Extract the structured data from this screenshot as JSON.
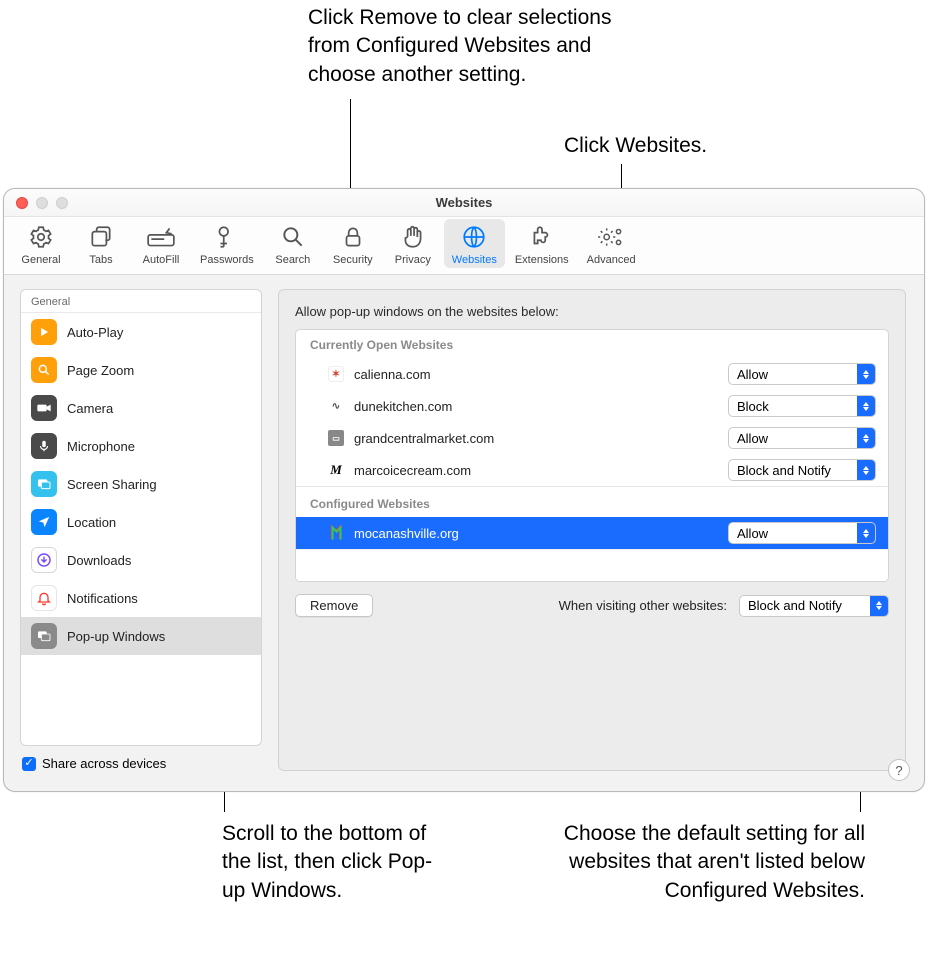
{
  "window_title": "Websites",
  "toolbar": [
    {
      "id": "general",
      "label": "General"
    },
    {
      "id": "tabs",
      "label": "Tabs"
    },
    {
      "id": "autofill",
      "label": "AutoFill"
    },
    {
      "id": "passwords",
      "label": "Passwords"
    },
    {
      "id": "search",
      "label": "Search"
    },
    {
      "id": "security",
      "label": "Security"
    },
    {
      "id": "privacy",
      "label": "Privacy"
    },
    {
      "id": "websites",
      "label": "Websites",
      "selected": true
    },
    {
      "id": "extensions",
      "label": "Extensions"
    },
    {
      "id": "advanced",
      "label": "Advanced"
    }
  ],
  "sidebar": {
    "header": "General",
    "items": [
      {
        "id": "autoplay",
        "label": "Auto-Play",
        "bg": "#ff9f0a"
      },
      {
        "id": "pagezoom",
        "label": "Page Zoom",
        "bg": "#ff9f0a"
      },
      {
        "id": "camera",
        "label": "Camera",
        "bg": "#4a4a4a"
      },
      {
        "id": "microphone",
        "label": "Microphone",
        "bg": "#4a4a4a"
      },
      {
        "id": "screenshare",
        "label": "Screen Sharing",
        "bg": "#0a84ff"
      },
      {
        "id": "location",
        "label": "Location",
        "bg": "#0a84ff"
      },
      {
        "id": "downloads",
        "label": "Downloads",
        "bg": "#7a4cff"
      },
      {
        "id": "notifications",
        "label": "Notifications",
        "bg": "#ffffff"
      },
      {
        "id": "popup",
        "label": "Pop-up Windows",
        "bg": "#8a8a8a",
        "selected": true
      }
    ],
    "share_label": "Share across devices",
    "share_checked": true
  },
  "main": {
    "caption": "Allow pop-up windows on the websites below:",
    "groups": {
      "open_header": "Currently Open Websites",
      "open": [
        {
          "site": "calienna.com",
          "setting": "Allow",
          "fav": "#d8452e"
        },
        {
          "site": "dunekitchen.com",
          "setting": "Block",
          "fav": "#555"
        },
        {
          "site": "grandcentralmarket.com",
          "setting": "Allow",
          "fav": "#555"
        },
        {
          "site": "marcoicecream.com",
          "setting": "Block and Notify",
          "fav": "#000"
        }
      ],
      "configured_header": "Configured Websites",
      "configured": [
        {
          "site": "mocanashville.org",
          "setting": "Allow",
          "selected": true
        }
      ]
    },
    "remove_label": "Remove",
    "default_label": "When visiting other websites:",
    "default_value": "Block and Notify"
  },
  "callouts": {
    "remove": "Click Remove to clear selections from Configured Websites and choose another setting.",
    "websites": "Click Websites.",
    "popup": "Scroll to the bottom of the list, then click Pop-up Windows.",
    "default": "Choose the default setting for all websites that aren't listed below Configured Websites."
  },
  "help": "?"
}
